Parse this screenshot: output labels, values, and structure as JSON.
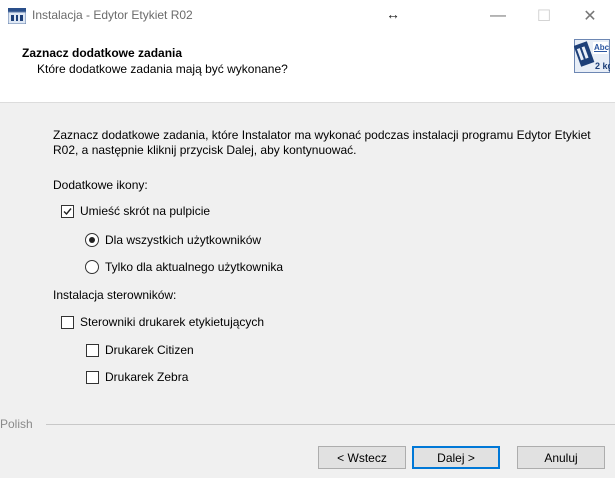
{
  "window": {
    "title": "Instalacja - Edytor Etykiet R02",
    "resize_glyph": "↔",
    "controls": {
      "minimize": "—",
      "maximize": "☐",
      "close": "✕"
    }
  },
  "header": {
    "title": "Zaznacz dodatkowe zadania",
    "subtitle": "Które dodatkowe zadania mają być wykonane?",
    "logo_text_top": "Abc",
    "logo_text_bottom": "2 kg"
  },
  "content": {
    "description": "Zaznacz dodatkowe zadania, które Instalator ma wykonać podczas instalacji programu Edytor Etykiet R02, a następnie kliknij przycisk Dalej, aby kontynuować.",
    "icons_section": {
      "label": "Dodatkowe ikony:",
      "desktop_shortcut": {
        "label": "Umieść skrót na pulpicie",
        "checked": true
      },
      "all_users": {
        "label": "Dla wszystkich użytkowników",
        "selected": true
      },
      "current_user": {
        "label": "Tylko dla aktualnego użytkownika",
        "selected": false
      }
    },
    "drivers_section": {
      "label": "Instalacja sterowników:",
      "label_printer_drivers": {
        "label": "Sterowniki drukarek etykietujących",
        "checked": false
      },
      "citizen": {
        "label": "Drukarek Citizen",
        "checked": false
      },
      "zebra": {
        "label": "Drukarek Zebra",
        "checked": false
      }
    }
  },
  "footer": {
    "language": "Polish",
    "back_label": "< Wstecz",
    "next_label": "Dalej >",
    "cancel_label": "Anuluj"
  },
  "colors": {
    "accent": "#0078d7",
    "content_bg": "#f0f0f0"
  }
}
